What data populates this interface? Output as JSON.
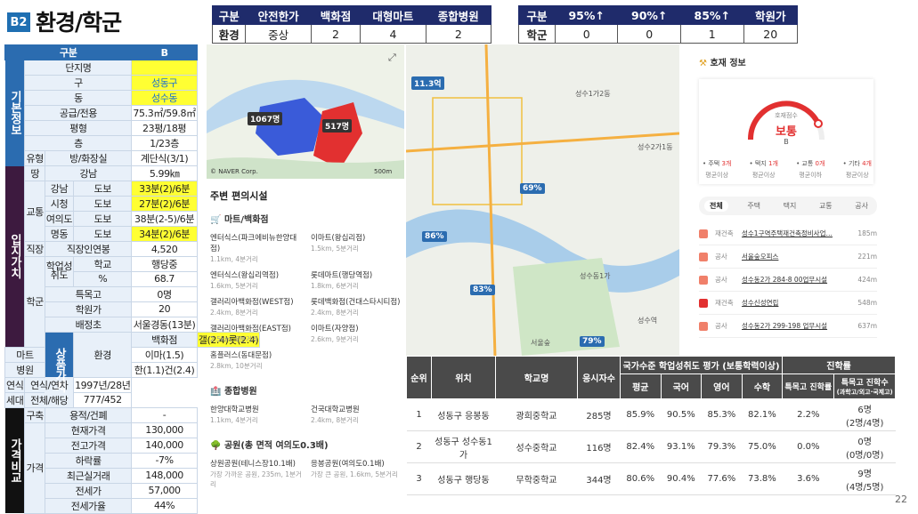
{
  "header": {
    "badge": "B2",
    "title": "환경/학군"
  },
  "env_table": {
    "headers": [
      "구분",
      "안전한가",
      "백화점",
      "대형마트",
      "종합병원"
    ],
    "row": [
      "환경",
      "중상",
      "2",
      "4",
      "2"
    ]
  },
  "school_table": {
    "headers": [
      "구분",
      "95%↑",
      "90%↑",
      "85%↑",
      "학원가"
    ],
    "row": [
      "학군",
      "0",
      "0",
      "1",
      "20"
    ]
  },
  "left_table": {
    "head": [
      "구분",
      "B"
    ],
    "sections": {
      "basic": "기본정보",
      "location": "입지가치",
      "product": "상품가치",
      "price": "가격비교"
    },
    "rows": {
      "danji": [
        "단지명",
        ""
      ],
      "gu": [
        "구",
        "성동구"
      ],
      "dong": [
        "동",
        "성수동"
      ],
      "area": [
        "공급/전용",
        "75.3㎡/59.8㎡"
      ],
      "pyeong": [
        "평형",
        "23평/18평"
      ],
      "floor": [
        "층",
        "1/23층"
      ],
      "type": [
        "유형",
        "방/화장실",
        "계단식(3/1)"
      ],
      "land": [
        "땅",
        "강남",
        "5.99㎞"
      ],
      "t1": [
        "교통",
        "강남",
        "도보",
        "33분(2)/6분"
      ],
      "t2": [
        "시청",
        "도보",
        "27분(2)/6분"
      ],
      "t3": [
        "여의도",
        "도보",
        "38분(2-5)/6분"
      ],
      "t4": [
        "명동",
        "도보",
        "34분(2)/6분"
      ],
      "job": [
        "직장",
        "직장인연봉",
        "4,520"
      ],
      "s1": [
        "학군",
        "학업성취도",
        "학교",
        "행당중"
      ],
      "s2": [
        "%",
        "68.7"
      ],
      "s3": [
        "특목고",
        "0명"
      ],
      "s4": [
        "학원가",
        "20"
      ],
      "s5": [
        "배정초",
        "서울경동(13분)"
      ],
      "e1": [
        "환경",
        "백화점",
        "갤(2.4)롯(2.4)"
      ],
      "e2": [
        "마트",
        "이마(1.5)"
      ],
      "e3": [
        "병원",
        "한(1.1)건(2.4)"
      ],
      "y1": [
        "연식",
        "연식/연차",
        "1997년/28년"
      ],
      "y2": [
        "세대",
        "전체/해당",
        "777/452"
      ],
      "g1": [
        "구축",
        "용적/건폐",
        "-"
      ],
      "p1": [
        "가격",
        "현재가격",
        "130,000"
      ],
      "p2": [
        "전고가격",
        "140,000"
      ],
      "p3": [
        "하락률",
        "-7%"
      ],
      "p4": [
        "최근실거래",
        "148,000"
      ],
      "p5": [
        "전세가",
        "57,000"
      ],
      "p6": [
        "전세가율",
        "44%"
      ]
    }
  },
  "map1": {
    "label1": "1067명",
    "label2": "517명",
    "credit": "© NAVER Corp.",
    "scale": "500m"
  },
  "map2": {
    "pins": [
      "69%",
      "86%",
      "83%",
      "79%",
      "11.3억"
    ],
    "areas": [
      "성수1가2동",
      "성수2가1동",
      "서울숲",
      "성수동1가",
      "성수역"
    ]
  },
  "facilities": {
    "title": "주변 편의시설",
    "mart_title": "마트/백화점",
    "marts": [
      {
        "n": "엔터식스(파크에비뉴한양대점)",
        "s": "1.1km, 4분거리"
      },
      {
        "n": "이마트(왕십리점)",
        "s": "1.5km, 5분거리"
      },
      {
        "n": "엔터식스(왕십리역점)",
        "s": "1.6km, 5분거리"
      },
      {
        "n": "롯데마트(행당역점)",
        "s": "1.8km, 6분거리"
      },
      {
        "n": "갤러리아백화점(WEST점)",
        "s": "2.4km, 8분거리"
      },
      {
        "n": "롯데백화점(건대스타시티점)",
        "s": "2.4km, 8분거리"
      },
      {
        "n": "갤러리아백화점(EAST점)",
        "s": "2.5km, 8분거리"
      },
      {
        "n": "이마트(자양점)",
        "s": "2.6km, 9분거리"
      },
      {
        "n": "홈플러스(동대문점)",
        "s": "2.8km, 10분거리"
      }
    ],
    "hosp_title": "종합병원",
    "hosps": [
      {
        "n": "한양대학교병원",
        "s": "1.1km, 4분거리"
      },
      {
        "n": "건국대학교병원",
        "s": "2.4km, 8분거리"
      }
    ],
    "park_title": "공원(총 면적 여의도0.3배)",
    "parks": [
      {
        "n": "상원공원(테니스장10.1배)",
        "s": "가장 가까운 공원, 235m, 1분거리"
      },
      {
        "n": "응봉공원(여의도0.1배)",
        "s": "가장 큰 공원, 1.6km, 5분거리"
      }
    ]
  },
  "info": {
    "title": "호재 정보",
    "gauge_label": "호재점수",
    "gauge_value": "보통",
    "gauge_sub": "B",
    "cats": [
      {
        "a": "• 주택",
        "b": "3개",
        "c": "평균이상"
      },
      {
        "a": "• 택지",
        "b": "1개",
        "c": "평균이상"
      },
      {
        "a": "• 교통",
        "b": "0개",
        "c": "평균이하"
      },
      {
        "a": "• 기타",
        "b": "4개",
        "c": "평균이상"
      }
    ],
    "tabs": [
      "전체",
      "주택",
      "택지",
      "교통",
      "공사"
    ],
    "items": [
      {
        "t": "재건축",
        "n": "성수1구역주택재건축정비사업…",
        "d": "185m"
      },
      {
        "t": "공사",
        "n": "서울숲오피스",
        "d": "221m"
      },
      {
        "t": "공사",
        "n": "성수동2가 284-8 00업무시설",
        "d": "424m"
      },
      {
        "t": "재건축",
        "n": "성수신성연립",
        "d": "548m"
      },
      {
        "t": "공사",
        "n": "성수동2가 299-198 업무시설",
        "d": "637m"
      }
    ]
  },
  "school_rank": {
    "headers": {
      "rank": "순위",
      "loc": "위치",
      "school": "학교명",
      "n": "응시자수",
      "eval": "국가수준 학업성취도 평가 (보통학력이상)",
      "avg": "평균",
      "kor": "국어",
      "eng": "영어",
      "math": "수학",
      "adv": "진학률",
      "sp": "특목고 진학률",
      "spn": "특목고 진학수",
      "spn_sub": "(과학고/외고·국제고)"
    },
    "rows": [
      [
        "1",
        "성동구 응봉동",
        "광희중학교",
        "285명",
        "85.9%",
        "90.5%",
        "85.3%",
        "82.1%",
        "2.2%",
        "6명",
        "(2명/4명)"
      ],
      [
        "2",
        "성동구 성수동1가",
        "성수중학교",
        "116명",
        "82.4%",
        "93.1%",
        "79.3%",
        "75.0%",
        "0.0%",
        "0명",
        "(0명/0명)"
      ],
      [
        "3",
        "성동구 행당동",
        "무학중학교",
        "344명",
        "80.6%",
        "90.4%",
        "77.6%",
        "73.8%",
        "3.6%",
        "9명",
        "(4명/5명)"
      ]
    ]
  },
  "page": "22",
  "colors": {
    "navy": "#1f2b6b",
    "blue": "#2b6cb0",
    "yellow": "#ffff33",
    "purple": "#3d1a3f",
    "red": "#e02020"
  }
}
